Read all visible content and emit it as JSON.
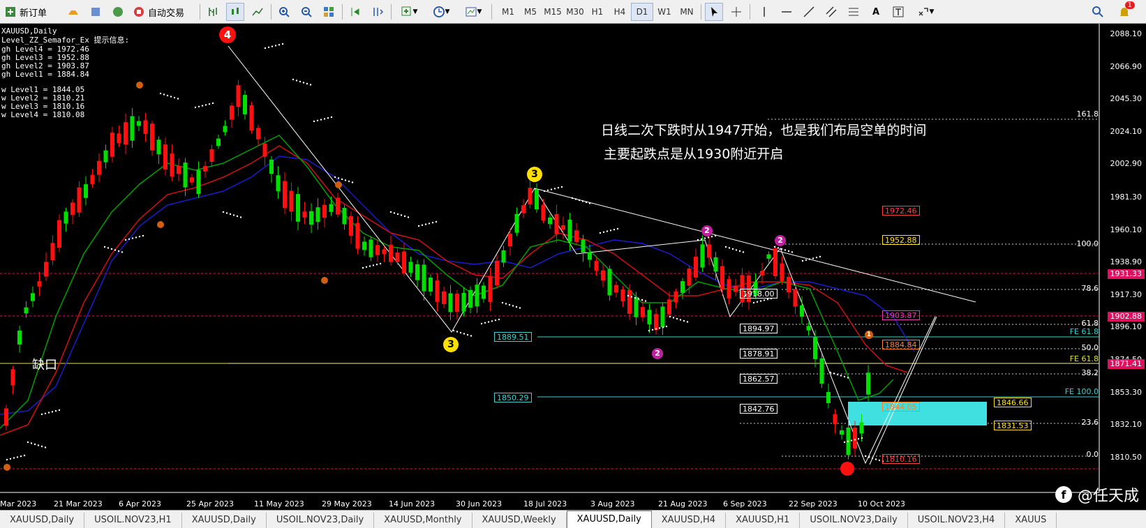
{
  "toolbar": {
    "new_order": "新订单",
    "auto_trade": "自动交易",
    "timeframes": [
      "M1",
      "M5",
      "M15",
      "M30",
      "H1",
      "H4",
      "D1",
      "W1",
      "MN"
    ],
    "active_timeframe": "D1",
    "notification_count": "1",
    "icons": [
      "new-order-icon",
      "gold-icon",
      "profile-icon",
      "chart-icon",
      "autotrade-icon",
      "bar-chart-icon",
      "candle-chart-icon",
      "line-chart-icon",
      "zoom-in-icon",
      "zoom-out-icon",
      "tile-icon",
      "scroll-icon",
      "shift-icon",
      "indicators-icon",
      "periods-icon",
      "templates-icon",
      "cursor-icon",
      "crosshair-icon",
      "vertical-line-icon",
      "horizontal-line-icon",
      "trendline-icon",
      "equidistant-channel-icon",
      "text-icon",
      "text-label-icon",
      "arrows-icon",
      "search-icon",
      "bell-icon"
    ]
  },
  "chart": {
    "symbol": "XAUUSD,Daily",
    "indicator_info": {
      "title": "Level_ZZ_Semafor_Ex 提示信息:",
      "high_levels": [
        "gh Level4 = 1972.46",
        "gh Level3 = 1952.88",
        "gh Level2 = 1903.87",
        "gh Level1 = 1884.84"
      ],
      "low_levels": [
        "w Level1 = 1844.05",
        "w Level2 = 1810.21",
        "w Level3 = 1810.16",
        "w Level4 = 1810.08"
      ]
    },
    "annotation_line1": "日线二次下跌时从1947开始，也是我们布局空单的时间",
    "annotation_line2": "主要起跌点是从1930附近开启",
    "gap_label": "缺口",
    "price_axis": [
      "2088.10",
      "2066.90",
      "2045.30",
      "2024.10",
      "2002.90",
      "1981.30",
      "1960.10",
      "1938.90",
      "1917.30",
      "1896.10",
      "1874.50",
      "1853.30",
      "1832.10",
      "1810.50"
    ],
    "badges": {
      "level_1931": "1931.33",
      "level_1902": "1902.88",
      "current_price": "1871.41"
    },
    "fib_labels": [
      "161.8",
      "100.0",
      "78.6",
      "61.8",
      "50.0",
      "38.2",
      "23.6",
      "0.0"
    ],
    "fe_labels": [
      "FE 61.8",
      "FE 61.8",
      "FE 100.0"
    ],
    "price_labels": {
      "l_1972": "1972.46",
      "l_1952": "1952.88",
      "l_1918": "1918.00",
      "l_1903": "1903.87",
      "l_1894": "1894.97",
      "l_1889": "1889.51",
      "l_1884": "1884.84",
      "l_1878": "1878.91",
      "l_1862": "1862.57",
      "l_1850": "1850.29",
      "l_1846": "1846.66",
      "l_1844": "1844.05",
      "l_1842": "1842.76",
      "l_1831": "1831.53",
      "l_1810": "1810.16"
    },
    "markers": {
      "m4": "4",
      "m3a": "3",
      "m3b": "3",
      "m2a": "2",
      "m2b": "2",
      "m2c": "2",
      "m1": "1"
    },
    "dates": [
      "Mar 2023",
      "21 Mar 2023",
      "6 Apr 2023",
      "25 Apr 2023",
      "11 May 2023",
      "29 May 2023",
      "14 Jun 2023",
      "30 Jun 2023",
      "18 Jul 2023",
      "3 Aug 2023",
      "21 Aug 2023",
      "6 Sep 2023",
      "22 Sep 2023",
      "10 Oct 2023"
    ],
    "watermark": "@任天成",
    "colors": {
      "bull": "#00e000",
      "bear": "#ff1010",
      "ma_blue": "#1c1ccc",
      "ma_red": "#d01010",
      "ma_green": "#00a000",
      "zone": "#40e0e0"
    }
  },
  "tabs": [
    "XAUUSD,Daily",
    "USOIL.NOV23,H1",
    "XAUUSD,Daily",
    "USOIL.NOV23,Daily",
    "XAUUSD,Monthly",
    "XAUUSD,Weekly",
    "XAUUSD,Daily",
    "XAUUSD,H4",
    "XAUUSD,H1",
    "USOIL.NOV23,Daily",
    "USOIL.NOV23,H4",
    "XAUUS"
  ],
  "active_tab_index": 6
}
